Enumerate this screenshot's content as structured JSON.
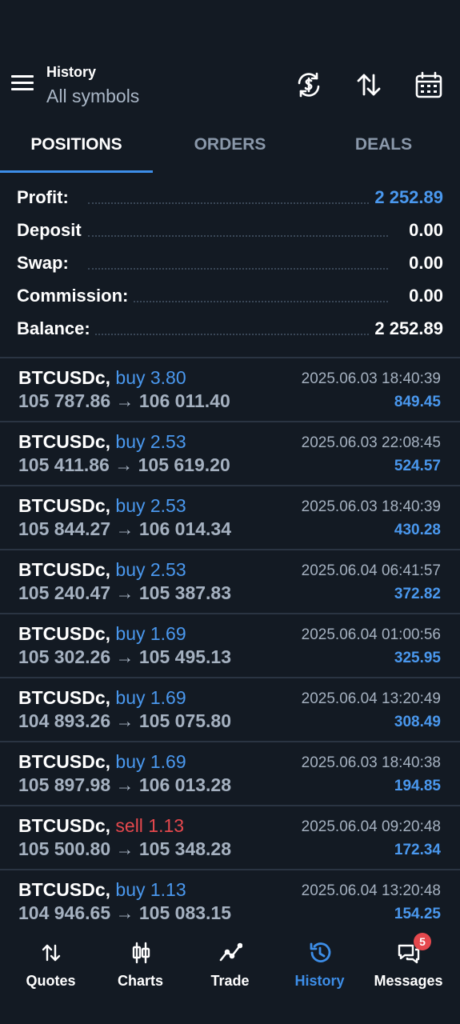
{
  "header": {
    "title": "History",
    "subtitle": "All symbols"
  },
  "tabs": [
    {
      "label": "POSITIONS",
      "active": true
    },
    {
      "label": "ORDERS",
      "active": false
    },
    {
      "label": "DEALS",
      "active": false
    }
  ],
  "summary": {
    "profit": {
      "label": "Profit:",
      "value": "2 252.89"
    },
    "deposit": {
      "label": "Deposit",
      "value": "0.00"
    },
    "swap": {
      "label": "Swap:",
      "value": "0.00"
    },
    "commission": {
      "label": "Commission:",
      "value": "0.00"
    },
    "balance": {
      "label": "Balance:",
      "value": "2 252.89"
    }
  },
  "positions": [
    {
      "symbol": "BTCUSDc,",
      "type": "buy 3.80",
      "side": "buy",
      "prices": "105 787.86 → 106 011.40",
      "time": "2025.06.03 18:40:39",
      "profit": "849.45"
    },
    {
      "symbol": "BTCUSDc,",
      "type": "buy 2.53",
      "side": "buy",
      "prices": "105 411.86 → 105 619.20",
      "time": "2025.06.03 22:08:45",
      "profit": "524.57"
    },
    {
      "symbol": "BTCUSDc,",
      "type": "buy 2.53",
      "side": "buy",
      "prices": "105 844.27 → 106 014.34",
      "time": "2025.06.03 18:40:39",
      "profit": "430.28"
    },
    {
      "symbol": "BTCUSDc,",
      "type": "buy 2.53",
      "side": "buy",
      "prices": "105 240.47 → 105 387.83",
      "time": "2025.06.04 06:41:57",
      "profit": "372.82"
    },
    {
      "symbol": "BTCUSDc,",
      "type": "buy 1.69",
      "side": "buy",
      "prices": "105 302.26 → 105 495.13",
      "time": "2025.06.04 01:00:56",
      "profit": "325.95"
    },
    {
      "symbol": "BTCUSDc,",
      "type": "buy 1.69",
      "side": "buy",
      "prices": "104 893.26 → 105 075.80",
      "time": "2025.06.04 13:20:49",
      "profit": "308.49"
    },
    {
      "symbol": "BTCUSDc,",
      "type": "buy 1.69",
      "side": "buy",
      "prices": "105 897.98 → 106 013.28",
      "time": "2025.06.03 18:40:38",
      "profit": "194.85"
    },
    {
      "symbol": "BTCUSDc,",
      "type": "sell 1.13",
      "side": "sell",
      "prices": "105 500.80 → 105 348.28",
      "time": "2025.06.04 09:20:48",
      "profit": "172.34"
    },
    {
      "symbol": "BTCUSDc,",
      "type": "buy 1.13",
      "side": "buy",
      "prices": "104 946.65 → 105 083.15",
      "time": "2025.06.04 13:20:48",
      "profit": "154.25"
    }
  ],
  "nav": [
    {
      "label": "Quotes",
      "icon": "arrows-updown-icon"
    },
    {
      "label": "Charts",
      "icon": "candlestick-icon"
    },
    {
      "label": "Trade",
      "icon": "trend-line-icon"
    },
    {
      "label": "History",
      "icon": "history-clock-icon",
      "active": true
    },
    {
      "label": "Messages",
      "icon": "chat-bubbles-icon",
      "badge": "5"
    }
  ],
  "colors": {
    "background": "#131a23",
    "accent": "#4a98ee",
    "sell": "#e5484d",
    "muted": "#a5b1c0"
  }
}
